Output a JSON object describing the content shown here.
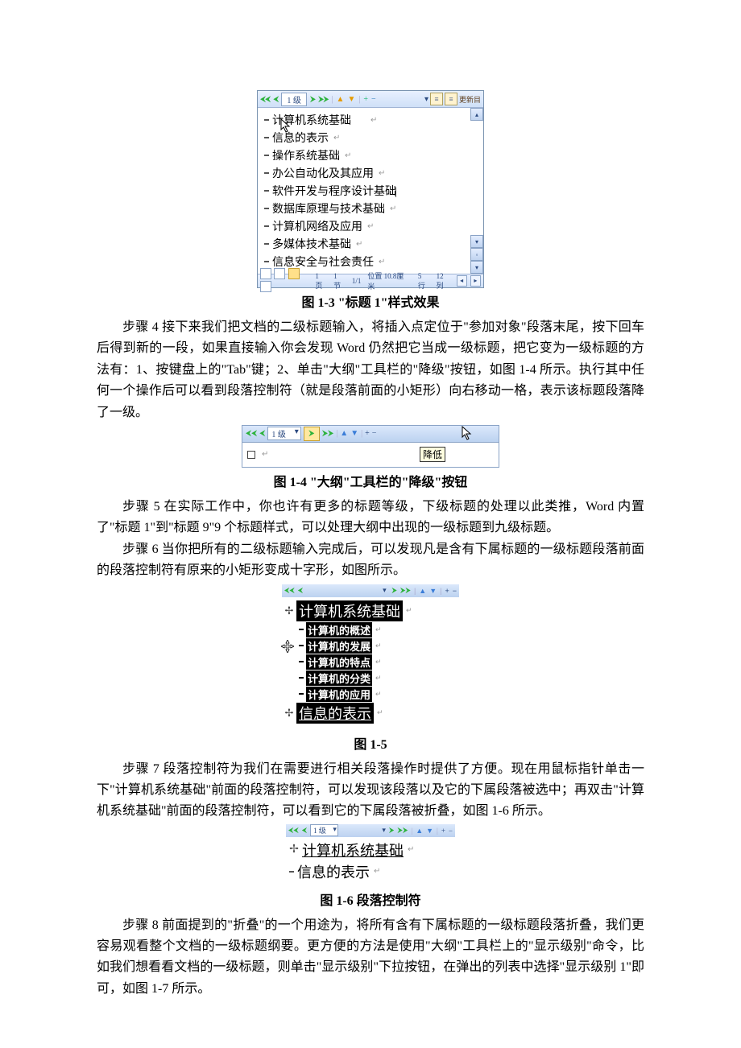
{
  "fig1_3": {
    "toolbar_level": "1 级",
    "items": [
      "计算机系统基础",
      "信息的表示",
      "操作系统基础",
      "办公自动化及其应用",
      "软件开发与程序设计基础",
      "数据库原理与技术基础",
      "计算机网络及应用",
      "多媒体技术基础",
      "信息安全与社会责任"
    ],
    "status": {
      "page": "1 页",
      "sec": "1 节",
      "pages": "1/1",
      "pos": "位置 10.8厘米",
      "line": "5 行",
      "col": "12 列"
    },
    "toolbar_update": "更新目",
    "caption": "图  1-3    \"标题 1\"样式效果"
  },
  "para4": "步骤 4  接下来我们把文档的二级标题输入，将插入点定位于\"参加对象\"段落末尾，按下回车后得到新的一段，如果直接输入你会发现 Word 仍然把它当成一级标题，把它变为一级标题的方法有：1、按键盘上的\"Tab\"键；2、单击\"大纲\"工具栏的\"降级\"按钮，如图 1-4 所示。执行其中任何一个操作后可以看到段落控制符（就是段落前面的小矩形）向右移动一格，表示该标题段落降了一级。",
  "fig1_4": {
    "level": "1 级",
    "tooltip": "降低",
    "caption": "图  1-4    \"大纲\"工具栏的\"降级\"按钮"
  },
  "para5": "步骤 5  在实际工作中，你也许有更多的标题等级，下级标题的处理以此类推，Word 内置了\"标题 1\"到\"标题 9\"9 个标题样式，可以处理大纲中出现的一级标题到九级标题。",
  "para6": "步骤 6  当你把所有的二级标题输入完成后，可以发现凡是含有下属标题的一级标题段落前面的段落控制符有原来的小矩形变成十字形，如图所示。",
  "fig1_5": {
    "h1a": "计算机系统基础",
    "subs": [
      "计算机的概述",
      "计算机的发展",
      "计算机的特点",
      "计算机的分类",
      "计算机的应用"
    ],
    "h1b": "信息的表示",
    "caption": "图  1-5"
  },
  "para7": "步骤 7  段落控制符为我们在需要进行相关段落操作时提供了方便。现在用鼠标指针单击一下\"计算机系统基础\"前面的段落控制符，可以发现该段落以及它的下属段落被选中；再双击\"计算机系统基础\"前面的段落控制符，可以看到它的下属段落被折叠，如图 1-6 所示。",
  "fig1_6": {
    "level": "1 级",
    "a": "计算机系统基础",
    "b": "信息的表示",
    "caption": "图  1-6    段落控制符"
  },
  "para8": "步骤 8  前面提到的\"折叠\"的一个用途为，将所有含有下属标题的一级标题段落折叠，我们更容易观看整个文档的一级标题纲要。更方便的方法是使用\"大纲\"工具栏上的\"显示级别\"命令，比如我们想看看文档的一级标题，则单击\"显示级别\"下拉按钮，在弹出的列表中选择\"显示级别 1\"即可，如图 1-7 所示。"
}
